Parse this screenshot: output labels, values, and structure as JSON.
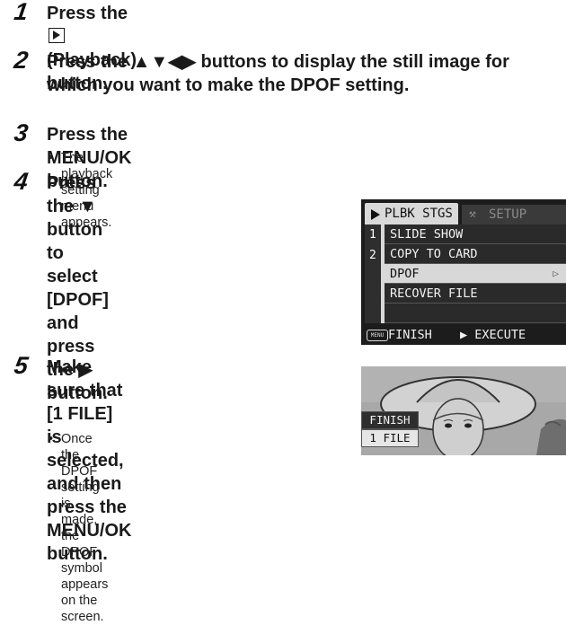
{
  "steps": [
    {
      "num": "1",
      "pre": "Press the ",
      "icon": "playback-icon",
      "post": " (Playback) button."
    },
    {
      "num": "2",
      "line1_pre": "Press the ",
      "arrows": "▲▼◀▶",
      "line1_post": " buttons to display the still image for",
      "line2": "which you want to make the DPOF setting."
    },
    {
      "num": "3",
      "title": "Press the MENU/OK button.",
      "bullet": "The playback setting menu appears."
    },
    {
      "num": "4",
      "line1": "Press the ▼ button to select",
      "line2": "[DPOF] and press the ▶",
      "line3": "button."
    },
    {
      "num": "5",
      "line1": "Make sure that [1 FILE] is",
      "line2": "selected, and then press the",
      "line3": "MENU/OK button.",
      "bullet_line1": "Once the DPOF setting is made, the",
      "bullet_line2": "DPOF symbol appears on the screen."
    }
  ],
  "screen1": {
    "tab_active": "PLBK STGS",
    "tab_inactive": "SETUP",
    "page_nums": [
      "1",
      "2"
    ],
    "menu_items": [
      "SLIDE SHOW",
      "COPY TO CARD",
      "DPOF",
      "RECOVER FILE"
    ],
    "selected_arrow": "▷",
    "menu_badge": "MENU",
    "footer_finish": "FINISH",
    "footer_execute": "▶ EXECUTE"
  },
  "screen2": {
    "menu_items": [
      "FINISH",
      "1 FILE"
    ]
  },
  "bullet_char": "•"
}
